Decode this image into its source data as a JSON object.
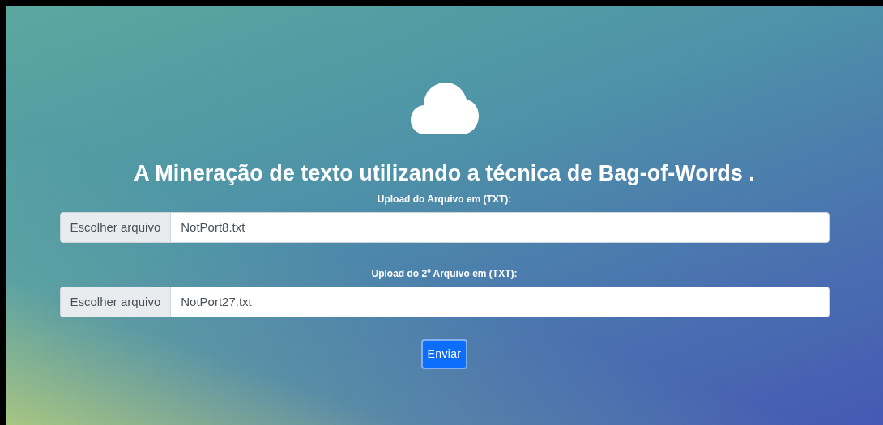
{
  "title": "A Mineração de texto utilizando a técnica de Bag-of-Words .",
  "uploads": [
    {
      "label": "Upload do Arquivo em (TXT):",
      "button": "Escolher arquivo",
      "value": "NotPort8.txt"
    },
    {
      "label": "Upload do 2º Arquivo em (TXT):",
      "button": "Escolher arquivo",
      "value": "NotPort27.txt"
    }
  ],
  "submit": "Enviar"
}
